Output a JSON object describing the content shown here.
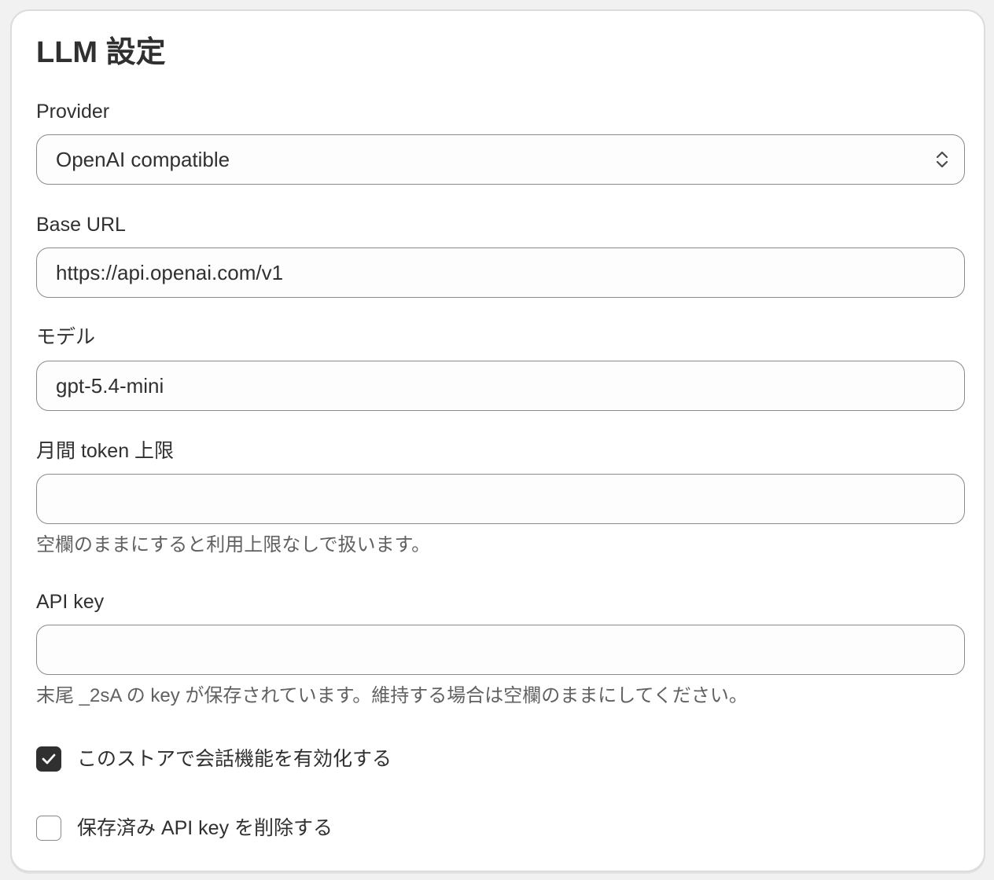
{
  "page": {
    "title": "LLM 設定"
  },
  "provider": {
    "label": "Provider",
    "selected": "OpenAI compatible"
  },
  "base_url": {
    "label": "Base URL",
    "value": "https://api.openai.com/v1"
  },
  "model": {
    "label": "モデル",
    "value": "gpt-5.4-mini"
  },
  "token_limit": {
    "label": "月間 token 上限",
    "value": "",
    "help": "空欄のままにすると利用上限なしで扱います。"
  },
  "api_key": {
    "label": "API key",
    "value": "",
    "help": "末尾 _2sA の key が保存されています。維持する場合は空欄のままにしてください。"
  },
  "enable_chat": {
    "label": "このストアで会話機能を有効化する",
    "checked": true
  },
  "delete_key": {
    "label": "保存済み API key を削除する",
    "checked": false
  },
  "colors": {
    "text": "#303030",
    "muted_text": "#616161",
    "border": "#8a8a8a",
    "checkbox_checked": "#303030"
  },
  "icons": {
    "select": "chevron-up-down-icon",
    "check": "checkmark-icon"
  }
}
